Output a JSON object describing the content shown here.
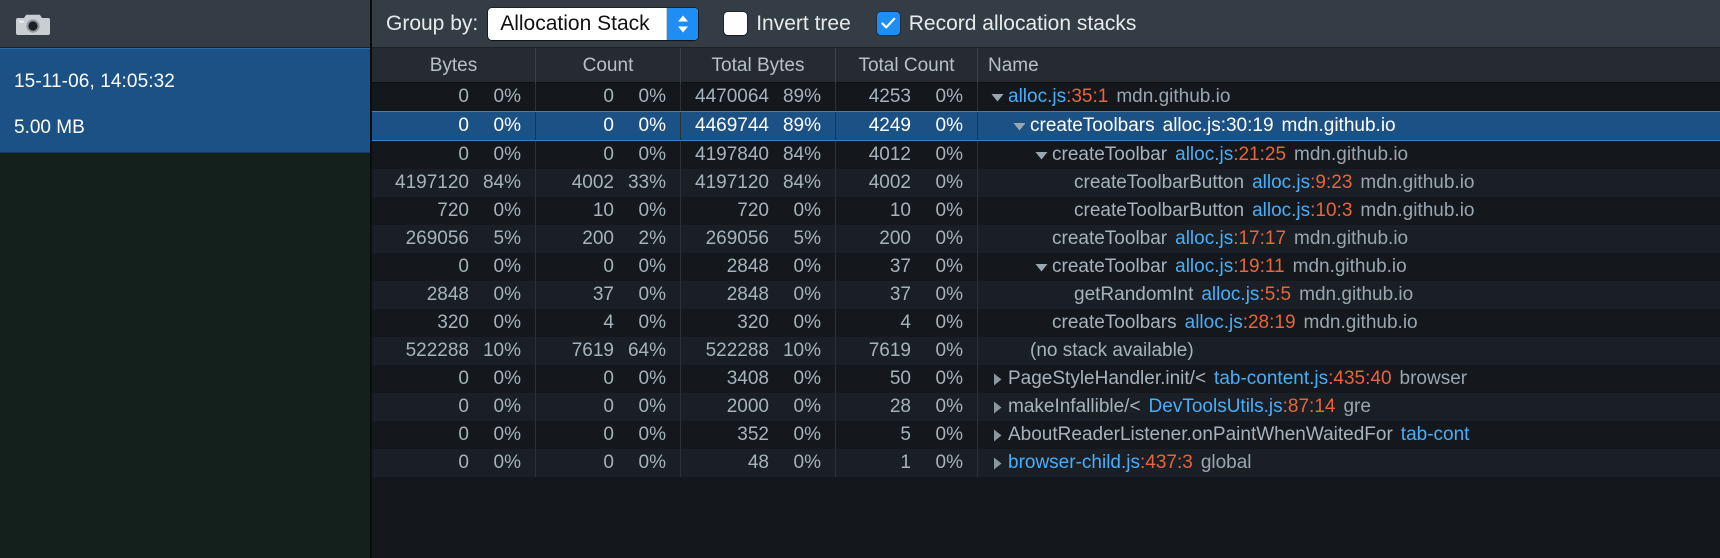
{
  "sidebar": {
    "toolbar": {
      "camera_icon": "camera-icon"
    },
    "snapshots": [
      {
        "timestamp": "15-11-06, 14:05:32",
        "size": "5.00 MB",
        "selected": true
      }
    ]
  },
  "toolbar": {
    "group_by_label": "Group by:",
    "group_by_value": "Allocation Stack",
    "group_by_options": [
      "Allocation Stack"
    ],
    "invert_tree_label": "Invert tree",
    "invert_tree_checked": false,
    "record_stacks_label": "Record allocation stacks",
    "record_stacks_checked": true
  },
  "colors": {
    "accent": "#1e8ef5",
    "selected_row": "#1c5185",
    "file_link": "#46aefb",
    "line_col": "#e8653a",
    "toolbar_bg": "#343c45"
  },
  "table": {
    "columns": [
      "Bytes",
      "Count",
      "Total Bytes",
      "Total Count",
      "Name"
    ],
    "rows": [
      {
        "bytes": "0",
        "bytes_pct": "0%",
        "count": "0",
        "count_pct": "0%",
        "total_bytes": "4470064",
        "total_bytes_pct": "89%",
        "total_count": "4253",
        "total_count_pct": "0%",
        "indent": 0,
        "twisty": "down",
        "fn": "",
        "file": "alloc.js",
        "linecol": ":35:1",
        "host": "mdn.github.io",
        "selected": false
      },
      {
        "bytes": "0",
        "bytes_pct": "0%",
        "count": "0",
        "count_pct": "0%",
        "total_bytes": "4469744",
        "total_bytes_pct": "89%",
        "total_count": "4249",
        "total_count_pct": "0%",
        "indent": 1,
        "twisty": "down",
        "fn": "createToolbars",
        "file": "alloc.js",
        "linecol": ":30:19",
        "host": "mdn.github.io",
        "selected": true
      },
      {
        "bytes": "0",
        "bytes_pct": "0%",
        "count": "0",
        "count_pct": "0%",
        "total_bytes": "4197840",
        "total_bytes_pct": "84%",
        "total_count": "4012",
        "total_count_pct": "0%",
        "indent": 2,
        "twisty": "down",
        "fn": "createToolbar",
        "file": "alloc.js",
        "linecol": ":21:25",
        "host": "mdn.github.io",
        "selected": false
      },
      {
        "bytes": "4197120",
        "bytes_pct": "84%",
        "count": "4002",
        "count_pct": "33%",
        "total_bytes": "4197120",
        "total_bytes_pct": "84%",
        "total_count": "4002",
        "total_count_pct": "0%",
        "indent": 3,
        "twisty": "none",
        "fn": "createToolbarButton",
        "file": "alloc.js",
        "linecol": ":9:23",
        "host": "mdn.github.io",
        "selected": false
      },
      {
        "bytes": "720",
        "bytes_pct": "0%",
        "count": "10",
        "count_pct": "0%",
        "total_bytes": "720",
        "total_bytes_pct": "0%",
        "total_count": "10",
        "total_count_pct": "0%",
        "indent": 3,
        "twisty": "none",
        "fn": "createToolbarButton",
        "file": "alloc.js",
        "linecol": ":10:3",
        "host": "mdn.github.io",
        "selected": false
      },
      {
        "bytes": "269056",
        "bytes_pct": "5%",
        "count": "200",
        "count_pct": "2%",
        "total_bytes": "269056",
        "total_bytes_pct": "5%",
        "total_count": "200",
        "total_count_pct": "0%",
        "indent": 2,
        "twisty": "none",
        "fn": "createToolbar",
        "file": "alloc.js",
        "linecol": ":17:17",
        "host": "mdn.github.io",
        "selected": false
      },
      {
        "bytes": "0",
        "bytes_pct": "0%",
        "count": "0",
        "count_pct": "0%",
        "total_bytes": "2848",
        "total_bytes_pct": "0%",
        "total_count": "37",
        "total_count_pct": "0%",
        "indent": 2,
        "twisty": "down",
        "fn": "createToolbar",
        "file": "alloc.js",
        "linecol": ":19:11",
        "host": "mdn.github.io",
        "selected": false
      },
      {
        "bytes": "2848",
        "bytes_pct": "0%",
        "count": "37",
        "count_pct": "0%",
        "total_bytes": "2848",
        "total_bytes_pct": "0%",
        "total_count": "37",
        "total_count_pct": "0%",
        "indent": 3,
        "twisty": "none",
        "fn": "getRandomInt",
        "file": "alloc.js",
        "linecol": ":5:5",
        "host": "mdn.github.io",
        "selected": false
      },
      {
        "bytes": "320",
        "bytes_pct": "0%",
        "count": "4",
        "count_pct": "0%",
        "total_bytes": "320",
        "total_bytes_pct": "0%",
        "total_count": "4",
        "total_count_pct": "0%",
        "indent": 2,
        "twisty": "none",
        "fn": "createToolbars",
        "file": "alloc.js",
        "linecol": ":28:19",
        "host": "mdn.github.io",
        "selected": false
      },
      {
        "bytes": "522288",
        "bytes_pct": "10%",
        "count": "7619",
        "count_pct": "64%",
        "total_bytes": "522288",
        "total_bytes_pct": "10%",
        "total_count": "7619",
        "total_count_pct": "0%",
        "indent": 1,
        "twisty": "none",
        "fn": "(no stack available)",
        "file": "",
        "linecol": "",
        "host": "",
        "selected": false
      },
      {
        "bytes": "0",
        "bytes_pct": "0%",
        "count": "0",
        "count_pct": "0%",
        "total_bytes": "3408",
        "total_bytes_pct": "0%",
        "total_count": "50",
        "total_count_pct": "0%",
        "indent": 0,
        "twisty": "right",
        "fn": "PageStyleHandler.init/<",
        "file": "tab-content.js",
        "linecol": ":435:40",
        "host": "browser",
        "selected": false
      },
      {
        "bytes": "0",
        "bytes_pct": "0%",
        "count": "0",
        "count_pct": "0%",
        "total_bytes": "2000",
        "total_bytes_pct": "0%",
        "total_count": "28",
        "total_count_pct": "0%",
        "indent": 0,
        "twisty": "right",
        "fn": "makeInfallible/<",
        "file": "DevToolsUtils.js",
        "linecol": ":87:14",
        "host": "gre",
        "selected": false
      },
      {
        "bytes": "0",
        "bytes_pct": "0%",
        "count": "0",
        "count_pct": "0%",
        "total_bytes": "352",
        "total_bytes_pct": "0%",
        "total_count": "5",
        "total_count_pct": "0%",
        "indent": 0,
        "twisty": "right",
        "fn": "AboutReaderListener.onPaintWhenWaitedFor",
        "file": "tab-cont",
        "linecol": "",
        "host": "",
        "selected": false
      },
      {
        "bytes": "0",
        "bytes_pct": "0%",
        "count": "0",
        "count_pct": "0%",
        "total_bytes": "48",
        "total_bytes_pct": "0%",
        "total_count": "1",
        "total_count_pct": "0%",
        "indent": 0,
        "twisty": "right",
        "fn": "",
        "file": "browser-child.js",
        "linecol": ":437:3",
        "host": "global",
        "selected": false
      }
    ]
  }
}
